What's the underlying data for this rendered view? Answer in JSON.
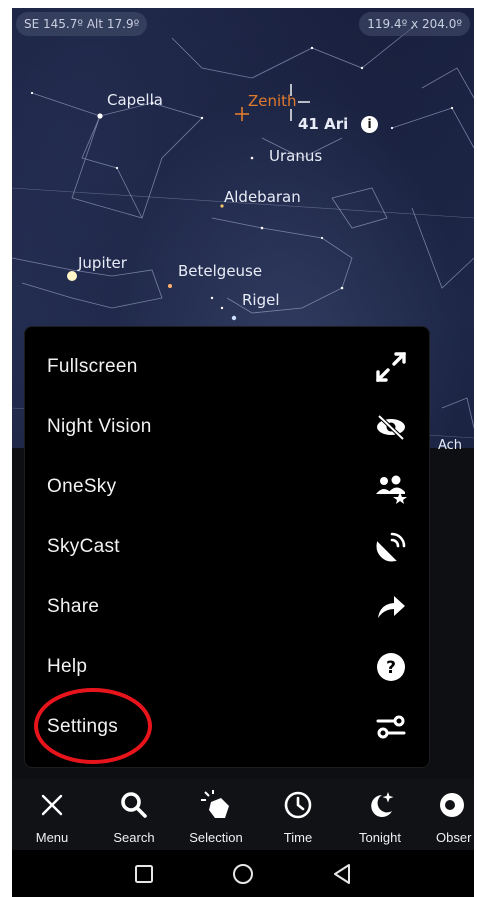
{
  "status": {
    "direction_readout": "SE 145.7º Alt 17.9º",
    "fov_readout": "119.4º x 204.0º"
  },
  "sky": {
    "labels": {
      "capella": "Capella",
      "zenith": "Zenith",
      "ari": "41 Ari",
      "uranus": "Uranus",
      "aldebaran": "Aldebaran",
      "jupiter": "Jupiter",
      "betelgeuse": "Betelgeuse",
      "rigel": "Rigel",
      "partial": "Ach"
    }
  },
  "menu": {
    "items": [
      {
        "label": "Fullscreen",
        "icon": "fullscreen-icon"
      },
      {
        "label": "Night Vision",
        "icon": "night-vision-icon"
      },
      {
        "label": "OneSky",
        "icon": "onesky-icon"
      },
      {
        "label": "SkyCast",
        "icon": "skycast-icon"
      },
      {
        "label": "Share",
        "icon": "share-icon"
      },
      {
        "label": "Help",
        "icon": "help-icon"
      },
      {
        "label": "Settings",
        "icon": "settings-sliders-icon"
      }
    ],
    "highlighted": "Settings",
    "highlight_color": "#e8141b"
  },
  "toolbar": {
    "items": [
      {
        "label": "Menu",
        "icon": "close-icon"
      },
      {
        "label": "Search",
        "icon": "search-icon"
      },
      {
        "label": "Selection",
        "icon": "selection-icon"
      },
      {
        "label": "Time",
        "icon": "clock-icon"
      },
      {
        "label": "Tonight",
        "icon": "moon-icon"
      },
      {
        "label": "Obser",
        "icon": "observe-icon"
      }
    ]
  },
  "colors": {
    "zenith": "#e07a2e",
    "panel": "#000000",
    "text": "#f2f2f2"
  }
}
